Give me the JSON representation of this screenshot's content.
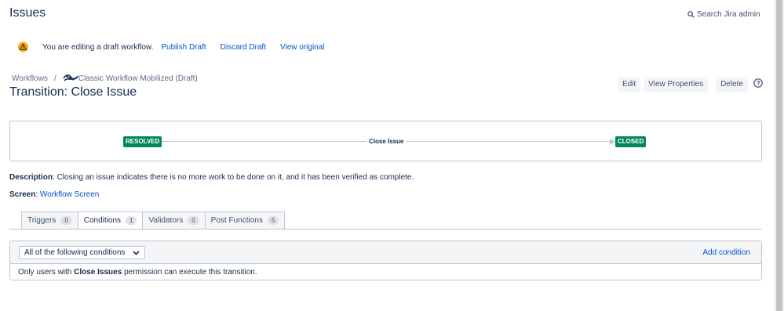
{
  "header": {
    "title": "Issues",
    "search_label": "Search Jira admin"
  },
  "draft_banner": {
    "message": "You are editing a draft workflow.",
    "publish": "Publish Draft",
    "discard": "Discard Draft",
    "view_original": "View original"
  },
  "breadcrumb": {
    "root": "Workflows",
    "separator": "/",
    "workflow": "Classic Workflow Mobilized (Draft)"
  },
  "page_title": "Transition: Close Issue",
  "actions": {
    "edit": "Edit",
    "view_properties": "View Properties",
    "delete": "Delete"
  },
  "diagram": {
    "from_status": "RESOLVED",
    "transition": "Close Issue",
    "to_status": "CLOSED",
    "status_color": "#00875a"
  },
  "description": {
    "label": "Description",
    "text": ": Closing an issue indicates there is no more work to be done on it, and it has been verified as complete."
  },
  "screen": {
    "label": "Screen",
    "separator": ":",
    "link": "Workflow Screen"
  },
  "tabs": [
    {
      "label": "Triggers",
      "count": "0"
    },
    {
      "label": "Conditions",
      "count": "1"
    },
    {
      "label": "Validators",
      "count": "0"
    },
    {
      "label": "Post Functions",
      "count": "5"
    }
  ],
  "conditions": {
    "mode": "All of the following conditions",
    "add_label": "Add condition",
    "rule_prefix": "Only users with ",
    "rule_permission": "Close Issues",
    "rule_suffix": " permission can execute this transition."
  },
  "icons": {
    "warning": "warning-icon",
    "search": "search-icon",
    "help": "help-icon",
    "chevron": "chevron-down-icon"
  },
  "colors": {
    "accent": "#0052cc",
    "status": "#00875a",
    "warning": "#ffab00"
  }
}
